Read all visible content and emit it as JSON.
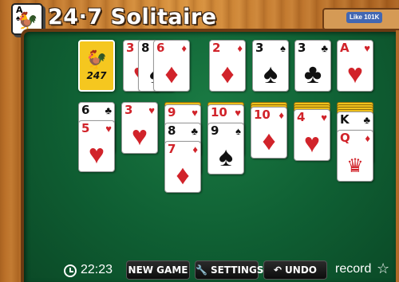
{
  "header": {
    "logo_rank": "A",
    "logo_suit": "♠",
    "logo_rooster": "🐓",
    "title": "24·7 Solitaire",
    "like_label": "Like 101K"
  },
  "stock": {
    "logo_text": "247",
    "rooster": "🐓"
  },
  "waste": [
    {
      "rank": "3",
      "suit": "♥",
      "color": "red"
    },
    {
      "rank": "8",
      "suit": "♠",
      "color": "black"
    },
    {
      "rank": "6",
      "suit": "♦",
      "color": "red"
    }
  ],
  "foundations": [
    {
      "rank": "2",
      "suit": "♦",
      "color": "red"
    },
    {
      "rank": "3",
      "suit": "♠",
      "color": "black"
    },
    {
      "rank": "3",
      "suit": "♣",
      "color": "black"
    },
    {
      "rank": "A",
      "suit": "♥",
      "color": "red"
    }
  ],
  "tableau": [
    {
      "hidden": 0,
      "cards": [
        {
          "rank": "6",
          "suit": "♣",
          "color": "black"
        },
        {
          "rank": "5",
          "suit": "♥",
          "color": "red"
        }
      ]
    },
    {
      "hidden": 0,
      "cards": [
        {
          "rank": "3",
          "suit": "♥",
          "color": "red"
        }
      ]
    },
    {
      "hidden": 1,
      "cards": [
        {
          "rank": "9",
          "suit": "♥",
          "color": "red"
        },
        {
          "rank": "8",
          "suit": "♣",
          "color": "black"
        },
        {
          "rank": "7",
          "suit": "♦",
          "color": "red"
        }
      ]
    },
    {
      "hidden": 1,
      "cards": [
        {
          "rank": "10",
          "suit": "♥",
          "color": "red"
        },
        {
          "rank": "9",
          "suit": "♠",
          "color": "black"
        }
      ]
    },
    {
      "hidden": 2,
      "cards": [
        {
          "rank": "10",
          "suit": "♦",
          "color": "red"
        }
      ]
    },
    {
      "hidden": 3,
      "cards": [
        {
          "rank": "4",
          "suit": "♥",
          "color": "red"
        }
      ]
    },
    {
      "hidden": 4,
      "cards": [
        {
          "rank": "K",
          "suit": "♣",
          "color": "black"
        },
        {
          "rank": "Q",
          "suit": "♦",
          "color": "red",
          "face": "♛"
        }
      ]
    }
  ],
  "footer": {
    "timer": "22:23",
    "new_game_label": "NEW GAME",
    "settings_label": "SETTINGS",
    "settings_icon": "wrench-icon",
    "undo_label": "UNDO",
    "undo_icon": "undo-arrow-icon",
    "record_label": "record",
    "record_icon": "star-outline-icon"
  },
  "colors": {
    "felt": "#0f5f33",
    "red_suit": "#d1232a",
    "card_back": "#f5c71f"
  }
}
